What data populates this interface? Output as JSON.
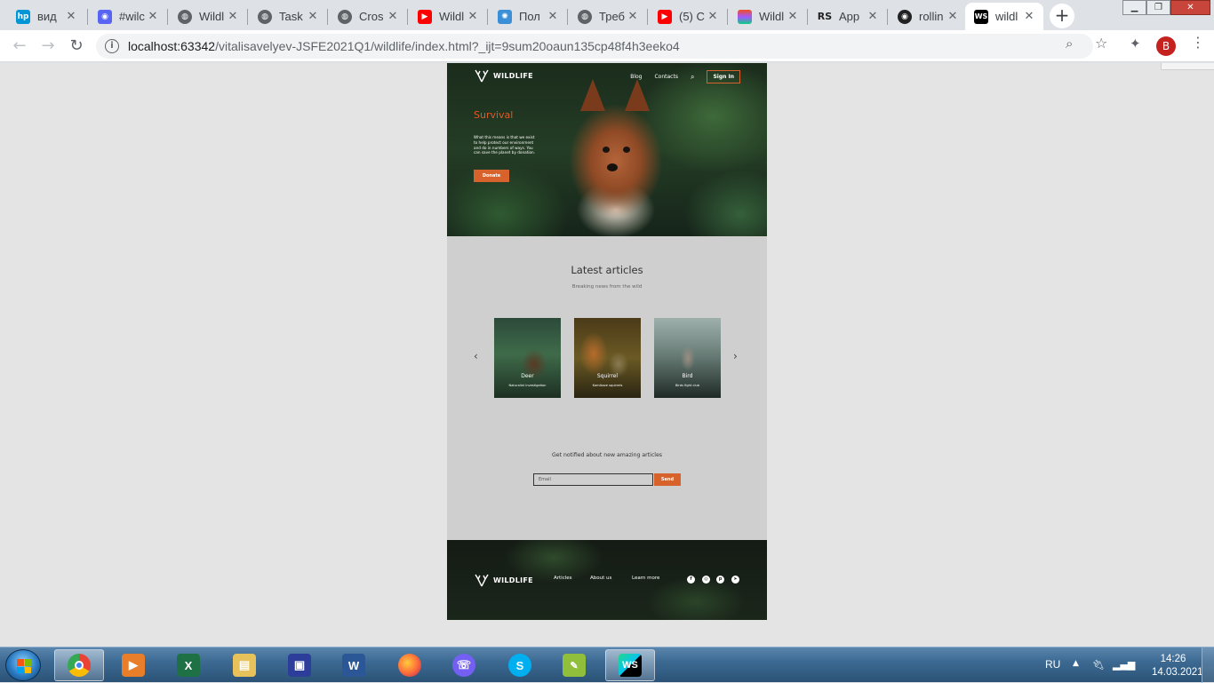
{
  "browser": {
    "tabs": [
      {
        "title": "вид",
        "icon": "hp-icon",
        "color": "#0096d6"
      },
      {
        "title": "#wilc",
        "icon": "discord-icon",
        "color": "#5865f2"
      },
      {
        "title": "Wildl",
        "icon": "globe-icon",
        "color": "#5f6368"
      },
      {
        "title": "Task",
        "icon": "globe-icon",
        "color": "#5f6368"
      },
      {
        "title": "Cros",
        "icon": "globe-icon",
        "color": "#5f6368"
      },
      {
        "title": "Wildl",
        "icon": "youtube-icon",
        "color": "#ff0000"
      },
      {
        "title": "Пол",
        "icon": "puzzle-icon",
        "color": "#3b8fd6"
      },
      {
        "title": "Треб",
        "icon": "globe-icon",
        "color": "#5f6368"
      },
      {
        "title": "(5) С",
        "icon": "youtube-icon",
        "color": "#ff0000"
      },
      {
        "title": "Wildl",
        "icon": "figma-icon",
        "color": "#a259ff"
      },
      {
        "title": "App",
        "icon": "rs-icon",
        "color": "#222222"
      },
      {
        "title": "rollin",
        "icon": "github-icon",
        "color": "#222222"
      },
      {
        "title": "wildl",
        "icon": "webstorm-icon",
        "color": "#000000"
      }
    ],
    "active_tab_index": 12,
    "url_host": "localhost:63342",
    "url_path": "/vitalisavelyev-JSFE2021Q1/wildlife/index.html?_ijt=9sum20oaun135cp48f4h3eeko4",
    "profile_initial": "B",
    "profile_color": "#c5221f"
  },
  "site": {
    "logo_text": "WILDLIFE",
    "nav": [
      "Blog",
      "Contacts"
    ],
    "sign_in": "Sign In",
    "hero_title": "Survival",
    "hero_text": "What this means is that we exist to help protect our environment and do in numbers of ways. You can save the planet by donation.",
    "donate": "Donate",
    "latest_title": "Latest articles",
    "latest_subtitle": "Breaking news from the wild",
    "articles": [
      {
        "title": "Deer",
        "subtitle": "Naturalist investigation"
      },
      {
        "title": "Squirrel",
        "subtitle": "Kamikaze squirrels"
      },
      {
        "title": "Bird",
        "subtitle": "Birds fight club"
      }
    ],
    "notify_text": "Get notified about new amazing articles",
    "email_placeholder": "Email",
    "send": "Send",
    "footer_links": [
      "Articles",
      "About us",
      "Learn more"
    ],
    "social": [
      "facebook-icon",
      "instagram-icon",
      "pinterest-icon",
      "telegram-icon"
    ],
    "accent": "#d8622b"
  },
  "taskbar": {
    "apps": [
      "chrome-icon",
      "media-player-icon",
      "excel-icon",
      "explorer-icon",
      "floppy-icon",
      "word-icon",
      "firefox-icon",
      "viber-icon",
      "skype-icon",
      "notepad-icon",
      "webstorm-icon"
    ],
    "active_app": "webstorm-icon",
    "language": "RU",
    "time": "14:26",
    "date": "14.03.2021"
  }
}
